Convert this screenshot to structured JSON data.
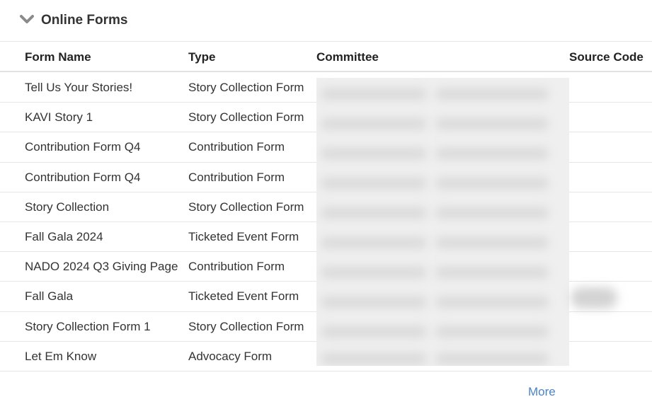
{
  "section": {
    "title": "Online Forms",
    "chevron_icon": "chevron-down-icon"
  },
  "table": {
    "headers": [
      "Form Name",
      "Type",
      "Committee",
      "Source Code"
    ],
    "rows": [
      {
        "name": "Tell Us Your Stories!",
        "type": "Story Collection Form"
      },
      {
        "name": "KAVI Story 1",
        "type": "Story Collection Form"
      },
      {
        "name": "Contribution Form Q4",
        "type": "Contribution Form"
      },
      {
        "name": "Contribution Form Q4",
        "type": "Contribution Form"
      },
      {
        "name": "Story Collection",
        "type": "Story Collection Form"
      },
      {
        "name": "Fall Gala 2024",
        "type": "Ticketed Event Form"
      },
      {
        "name": "NADO 2024 Q3 Giving Page",
        "type": "Contribution Form"
      },
      {
        "name": "Fall Gala",
        "type": "Ticketed Event Form"
      },
      {
        "name": "Story Collection Form 1",
        "type": "Story Collection Form"
      },
      {
        "name": "Let Em Know",
        "type": "Advocacy Form"
      }
    ]
  },
  "footer": {
    "more_label": "More"
  },
  "colors": {
    "link": "#4b84c7",
    "header_text": "#222222",
    "divider": "#e6e6e6"
  }
}
